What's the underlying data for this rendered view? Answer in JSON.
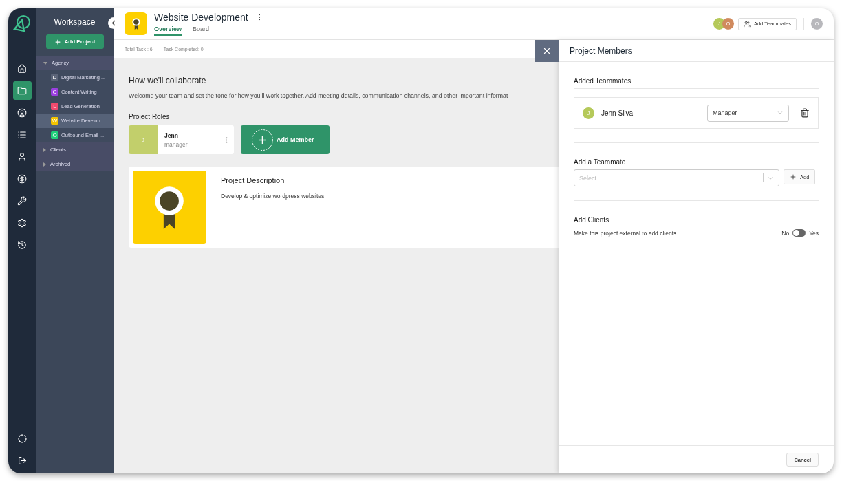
{
  "rail": {
    "items": [
      {
        "selected": false
      },
      {
        "selected": true
      },
      {
        "selected": false
      },
      {
        "selected": false
      },
      {
        "selected": false
      },
      {
        "selected": false
      },
      {
        "selected": false
      },
      {
        "selected": false
      },
      {
        "selected": false
      }
    ]
  },
  "workspace": {
    "title": "Workspace",
    "add_button": "Add Project",
    "groups": [
      {
        "label": "Agency",
        "expanded": true,
        "children": [
          {
            "badge": "D",
            "label": "Digital Marketing ...",
            "color": "#5b6478",
            "selected": false
          },
          {
            "badge": "C",
            "label": "Content Writing",
            "color": "#9b3fe0",
            "selected": false
          },
          {
            "badge": "L",
            "label": "Lead Generation",
            "color": "#f04a6e",
            "selected": false
          },
          {
            "badge": "W",
            "label": "Website Develop...",
            "color": "#f5c400",
            "selected": true
          },
          {
            "badge": "O",
            "label": "Outbound Email ...",
            "color": "#1fd07a",
            "selected": false
          }
        ]
      },
      {
        "label": "Clients",
        "expanded": false
      },
      {
        "label": "Archived",
        "expanded": false
      }
    ]
  },
  "project": {
    "title": "Website Development",
    "tabs": [
      {
        "label": "Overview",
        "selected": true
      },
      {
        "label": "Board",
        "selected": false
      }
    ],
    "stats": [
      "Total Task : 6",
      "Task Completed: 0"
    ]
  },
  "header": {
    "avatars": [
      {
        "initial": "J",
        "color": "#b5c95a"
      },
      {
        "initial": "O",
        "color": "#d08a5e"
      }
    ],
    "add_teammates": "Add Teammates",
    "user_initial": "O"
  },
  "overview": {
    "collab_title": "How we'll collaborate",
    "collab_text": "Welcome your team and set the tone for how you’ll work together. Add meeting details, communication channels, and other important informat",
    "roles_title": "Project Roles",
    "roles": [
      {
        "initial": "J",
        "name": "Jenn",
        "role": "manager",
        "color": "#c2cf6b"
      }
    ],
    "add_member": "Add Member",
    "description": {
      "title": "Project Description",
      "text": "Develop & optimize wordpress websites"
    }
  },
  "drawer": {
    "title": "Project Members",
    "added_title": "Added Teammates",
    "members": [
      {
        "initial": "J",
        "name": "Jenn Silva",
        "role": "Manager",
        "color": "#b5c95a"
      }
    ],
    "add_title": "Add a Teammate",
    "select_placeholder": "Select...",
    "add_button": "Add",
    "clients_title": "Add Clients",
    "clients_text": "Make this project external to add clients",
    "toggle": {
      "off_label": "No",
      "on_label": "Yes",
      "on": false
    },
    "cancel": "Cancel"
  }
}
